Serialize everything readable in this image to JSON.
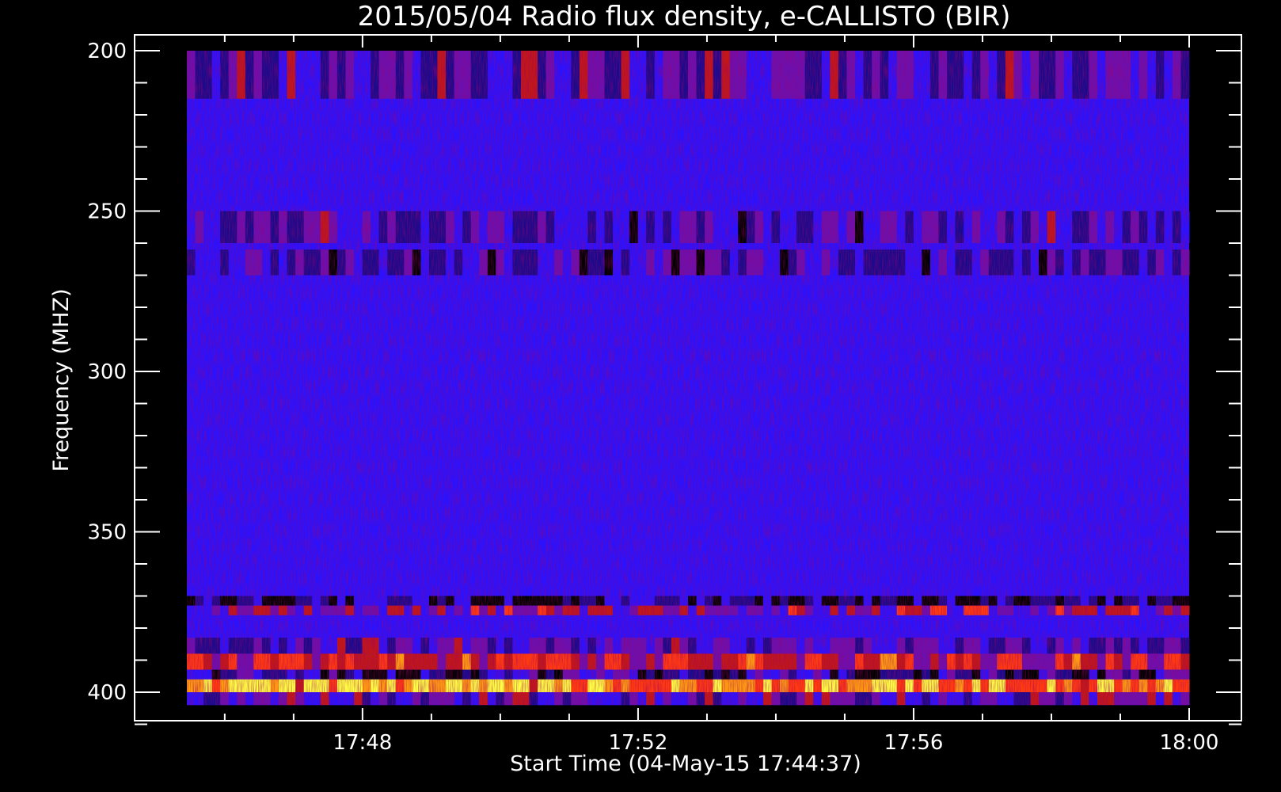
{
  "chart_data": {
    "type": "heatmap",
    "title": "2015/05/04  Radio flux density, e-CALLISTO (BIR)",
    "xlabel": "Start Time (04-May-15 17:44:37)",
    "ylabel": "Frequency (MHZ)",
    "x_unit": "minutes after 17:44",
    "xlim": [
      1.45,
      16.0
    ],
    "data_xlim": [
      1.45,
      16.0
    ],
    "ylim": [
      200,
      410
    ],
    "data_ylim": [
      200,
      404
    ],
    "y_inverted": true,
    "x_ticks": [
      {
        "value": 4,
        "label": "17:48"
      },
      {
        "value": 8,
        "label": "17:52"
      },
      {
        "value": 12,
        "label": "17:56"
      },
      {
        "value": 16,
        "label": "18:00"
      }
    ],
    "x_minor_step": 1,
    "y_ticks": [
      {
        "value": 200,
        "label": "200"
      },
      {
        "value": 250,
        "label": "250"
      },
      {
        "value": 300,
        "label": "300"
      },
      {
        "value": 350,
        "label": "350"
      },
      {
        "value": 400,
        "label": "400"
      }
    ],
    "y_minor_step": 10,
    "grid": false,
    "colormap": [
      "#000000",
      "#1a0a8c",
      "#2a12ff",
      "#6a10b0",
      "#c01818",
      "#ff3a10",
      "#ff9a10",
      "#ffff40"
    ],
    "background_color": "#2a12ff",
    "bands": [
      {
        "y0": 200,
        "y1": 215,
        "level": 0.3
      },
      {
        "y0": 250,
        "y1": 260,
        "level": 0.28
      },
      {
        "y0": 262,
        "y1": 270,
        "level": 0.26
      },
      {
        "y0": 370,
        "y1": 373,
        "level": 0.12
      },
      {
        "y0": 373,
        "y1": 376,
        "level": 0.45
      },
      {
        "y0": 383,
        "y1": 388,
        "level": 0.3
      },
      {
        "y0": 388,
        "y1": 393,
        "level": 0.6
      },
      {
        "y0": 393,
        "y1": 396,
        "level": 0.2
      },
      {
        "y0": 396,
        "y1": 400,
        "level": 0.85
      },
      {
        "y0": 400,
        "y1": 404,
        "level": 0.35
      }
    ]
  }
}
